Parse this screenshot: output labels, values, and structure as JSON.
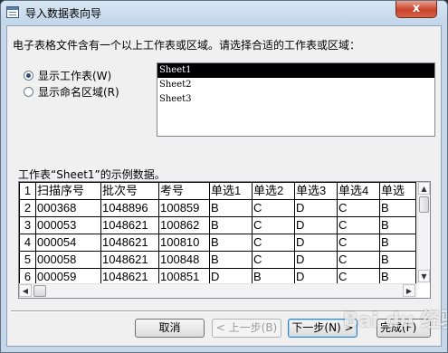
{
  "window": {
    "title": "导入数据表向导",
    "close_symbol": "x"
  },
  "prompt": "电子表格文件含有一个以上工作表或区域。请选择合适的工作表或区域：",
  "options": [
    {
      "label": "显示工作表(W)",
      "selected": true
    },
    {
      "label": "显示命名区域(R)",
      "selected": false
    }
  ],
  "sheet_list": [
    "Sheet1",
    "Sheet2",
    "Sheet3"
  ],
  "selected_sheet": "Sheet1",
  "sample_caption": "工作表“Sheet1”的示例数据。",
  "table": {
    "headers": [
      "扫描序号",
      "批次号",
      "考号",
      "单选1",
      "单选2",
      "单选3",
      "单选4",
      "单选"
    ],
    "rows": [
      {
        "num": "1",
        "cells": [
          "扫描序号",
          "批次号",
          "考号",
          "单选1",
          "单选2",
          "单选3",
          "单选4",
          "单选"
        ]
      },
      {
        "num": "2",
        "cells": [
          "000368",
          "1048896",
          "100859",
          "B",
          "C",
          "D",
          "C",
          "B"
        ]
      },
      {
        "num": "3",
        "cells": [
          "000053",
          "1048621",
          "100862",
          "B",
          "C",
          "D",
          "C",
          "B"
        ]
      },
      {
        "num": "4",
        "cells": [
          "000054",
          "1048621",
          "100810",
          "B",
          "C",
          "D",
          "C",
          "B"
        ]
      },
      {
        "num": "5",
        "cells": [
          "000058",
          "1048621",
          "100848",
          "B",
          "C",
          "D",
          "C",
          "B"
        ]
      },
      {
        "num": "6",
        "cells": [
          "000059",
          "1048621",
          "100851",
          "D",
          "B",
          "D",
          "C",
          "B"
        ]
      }
    ]
  },
  "buttons": {
    "cancel": "取消",
    "back": "< 上一步(B)",
    "next": "下一步(N) >",
    "finish": "完成(F)"
  },
  "watermark": "Bai du 经验"
}
